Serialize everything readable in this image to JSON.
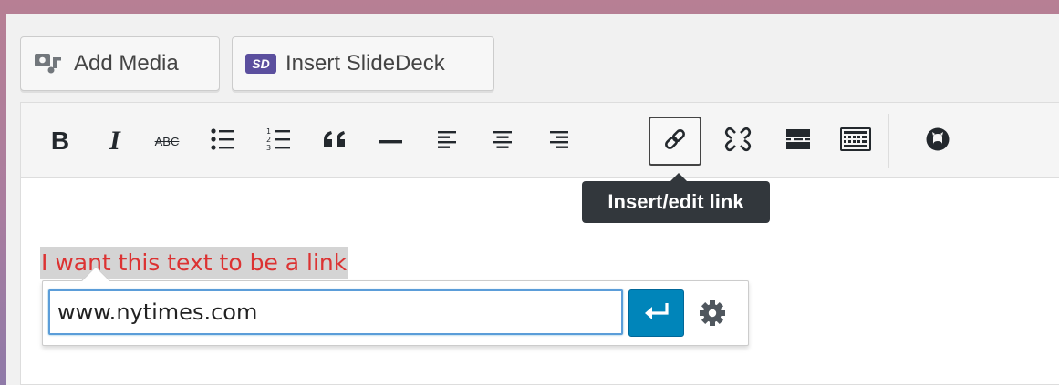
{
  "media_buttons": {
    "add_media_label": "Add Media",
    "insert_slidedeck_label": "Insert SlideDeck",
    "slidedeck_logo_text": "SD"
  },
  "toolbar": {
    "buttons": [
      {
        "name": "bold",
        "icon": "bold-icon"
      },
      {
        "name": "italic",
        "icon": "italic-icon"
      },
      {
        "name": "strikethrough",
        "icon": "strikethrough-icon",
        "glyph": "ABC"
      },
      {
        "name": "bulleted-list",
        "icon": "bulleted-list-icon"
      },
      {
        "name": "numbered-list",
        "icon": "numbered-list-icon"
      },
      {
        "name": "blockquote",
        "icon": "blockquote-icon"
      },
      {
        "name": "horizontal-line",
        "icon": "horizontal-line-icon"
      },
      {
        "name": "align-left",
        "icon": "align-left-icon"
      },
      {
        "name": "align-center",
        "icon": "align-center-icon"
      },
      {
        "name": "align-right",
        "icon": "align-right-icon"
      },
      {
        "name": "insert-link",
        "icon": "link-icon",
        "active": true
      },
      {
        "name": "remove-link",
        "icon": "unlink-icon"
      },
      {
        "name": "read-more",
        "icon": "read-more-icon"
      },
      {
        "name": "toolbar-toggle",
        "icon": "keyboard-icon"
      },
      {
        "name": "github",
        "icon": "github-icon"
      }
    ],
    "glyphs": {
      "bold": "B",
      "italic": "I",
      "strikethrough": "ABC",
      "blockquote": "❝❝"
    }
  },
  "tooltip": {
    "text": "Insert/edit link"
  },
  "editor": {
    "selected_text": "I want this text to be a link",
    "selected_text_color": "#dc3232"
  },
  "link_popup": {
    "url_value": "www.nytimes.com",
    "apply_icon": "enter-icon",
    "settings_icon": "gear-icon"
  },
  "colors": {
    "accent": "#0085ba",
    "tooltip_bg": "#32373c"
  }
}
